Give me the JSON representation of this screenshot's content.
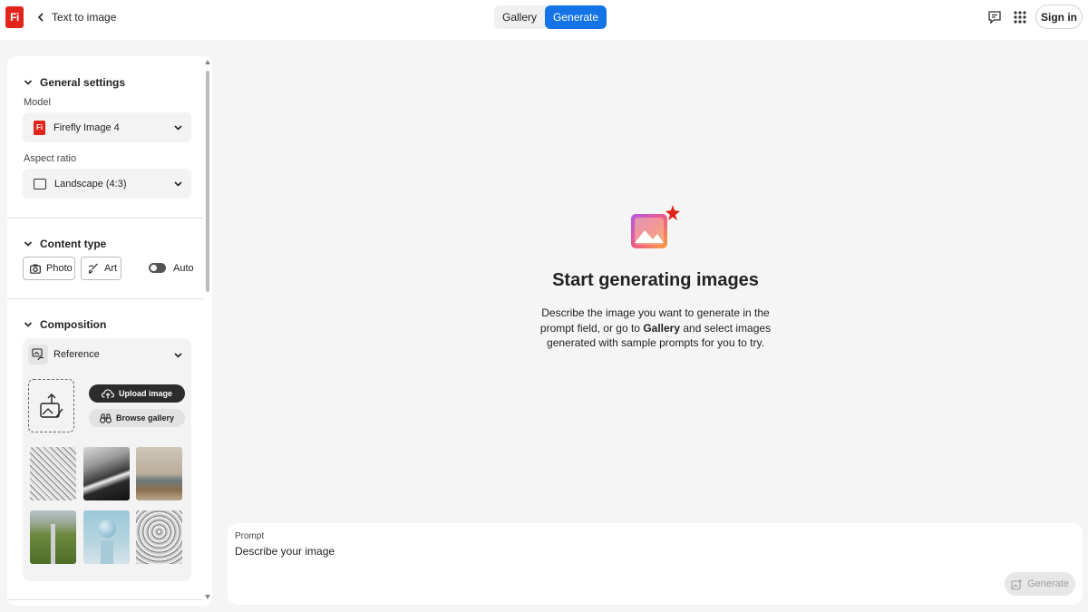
{
  "header": {
    "logo_text": "Fi",
    "breadcrumb": "Text to image",
    "tabs": [
      {
        "label": "Gallery",
        "active": false
      },
      {
        "label": "Generate",
        "active": true
      }
    ],
    "sign_in_label": "Sign in",
    "icons": [
      "back-arrow-icon",
      "feedback-icon",
      "apps-grid-icon"
    ]
  },
  "sidebar": {
    "general": {
      "title": "General settings",
      "model_label": "Model",
      "model_value": "Firefly Image 4",
      "model_badge": "Fi",
      "aspect_label": "Aspect ratio",
      "aspect_value": "Landscape (4:3)"
    },
    "content_type": {
      "title": "Content type",
      "photo_label": "Photo",
      "art_label": "Art",
      "auto_label": "Auto",
      "auto_on": true
    },
    "composition": {
      "title": "Composition",
      "reference_label": "Reference",
      "upload_label": "Upload image",
      "browse_label": "Browse gallery"
    }
  },
  "main": {
    "title": "Start generating images",
    "desc_before": "Describe the image you want to generate in the prompt field, or go to ",
    "desc_link": "Gallery",
    "desc_after": " and select images generated with sample prompts for you to try."
  },
  "prompt": {
    "label": "Prompt",
    "placeholder": "Describe your image",
    "generate_label": "Generate"
  },
  "colors": {
    "brand_red": "#e1251b",
    "accent_blue": "#1473e6",
    "background": "#f5f5f5"
  }
}
